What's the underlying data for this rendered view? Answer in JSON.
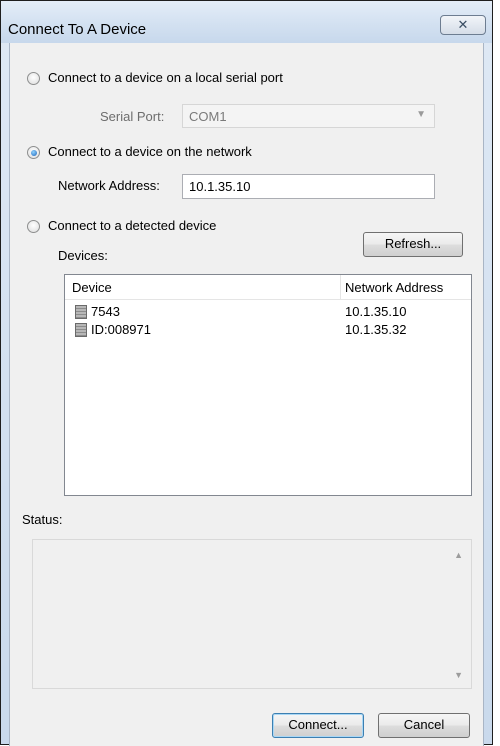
{
  "window": {
    "title": "Connect To A Device",
    "close_glyph": "✕"
  },
  "serial": {
    "radio_label": "Connect to a device on a local serial port",
    "port_label": "Serial Port:",
    "port_value": "COM1",
    "selected": false
  },
  "network": {
    "radio_label": "Connect to a device on the network",
    "address_label": "Network Address:",
    "address_value": "10.1.35.10",
    "selected": true
  },
  "detected": {
    "radio_label": "Connect to a detected device",
    "devices_label": "Devices:",
    "refresh_label": "Refresh...",
    "columns": [
      "Device",
      "Network Address"
    ],
    "rows": [
      {
        "device": "7543",
        "address": "10.1.35.10",
        "icon": "device-icon"
      },
      {
        "device": "ID:008971",
        "address": "10.1.35.32",
        "icon": "device-icon"
      }
    ],
    "selected": false
  },
  "status": {
    "label": "Status:",
    "text": ""
  },
  "buttons": {
    "connect_label": "Connect...",
    "cancel_label": "Cancel"
  }
}
